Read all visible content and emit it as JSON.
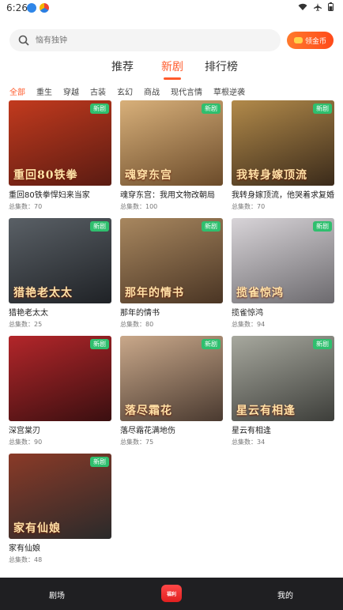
{
  "status": {
    "time": "6:26"
  },
  "search": {
    "placeholder": "恼有独钟"
  },
  "coin_button": {
    "label": "领金币"
  },
  "main_tabs": [
    {
      "label": "推荐"
    },
    {
      "label": "新剧"
    },
    {
      "label": "排行榜"
    }
  ],
  "categories": [
    "全部",
    "重生",
    "穿越",
    "古装",
    "玄幻",
    "商战",
    "现代言情",
    "草根逆袭"
  ],
  "cards": [
    {
      "name": "重回80铁拳悍妇来当家",
      "eps": "总集数：70",
      "badge": "新剧",
      "poster_text": "重回80铁拳",
      "c1": "#5a1b12",
      "c2": "#c23a1e"
    },
    {
      "name": "魂穿东宫：我用文物改朝局",
      "eps": "总集数：100",
      "badge": "新剧",
      "poster_text": "魂穿东宫",
      "c1": "#6b4b2a",
      "c2": "#d8b07a"
    },
    {
      "name": "我转身嫁顶流，他哭着求复婚",
      "eps": "总集数：70",
      "badge": "新剧",
      "poster_text": "我转身嫁顶流",
      "c1": "#3a2a1a",
      "c2": "#b28a4a"
    },
    {
      "name": "猎艳老太太",
      "eps": "总集数：25",
      "badge": "新剧",
      "poster_text": "猎艳老太太",
      "c1": "#1f2226",
      "c2": "#5a6066"
    },
    {
      "name": "那年的情书",
      "eps": "总集数：80",
      "badge": "新剧",
      "poster_text": "那年的情书",
      "c1": "#4a3524",
      "c2": "#a8875f"
    },
    {
      "name": "揽雀惊鸿",
      "eps": "总集数：94",
      "badge": "新剧",
      "poster_text": "揽雀惊鸿",
      "c1": "#6c6a6e",
      "c2": "#d8d4d8"
    },
    {
      "name": "深宫棠刃",
      "eps": "总集数：90",
      "badge": "新剧",
      "poster_text": "",
      "c1": "#3a0f10",
      "c2": "#b3262a"
    },
    {
      "name": "落尽霜花满地伤",
      "eps": "总集数：75",
      "badge": "新剧",
      "poster_text": "落尽霜花",
      "c1": "#4a3a30",
      "c2": "#c9a88a"
    },
    {
      "name": "星云有相逢",
      "eps": "总集数：34",
      "badge": "新剧",
      "poster_text": "星云有相逢",
      "c1": "#3d3e3a",
      "c2": "#a7a89e"
    },
    {
      "name": "家有仙娘",
      "eps": "总集数：48",
      "badge": "新剧",
      "poster_text": "家有仙娘",
      "c1": "#2a2a2a",
      "c2": "#8a3a28"
    }
  ],
  "nav": {
    "left": "剧场",
    "center": "福利",
    "right": "我的"
  }
}
